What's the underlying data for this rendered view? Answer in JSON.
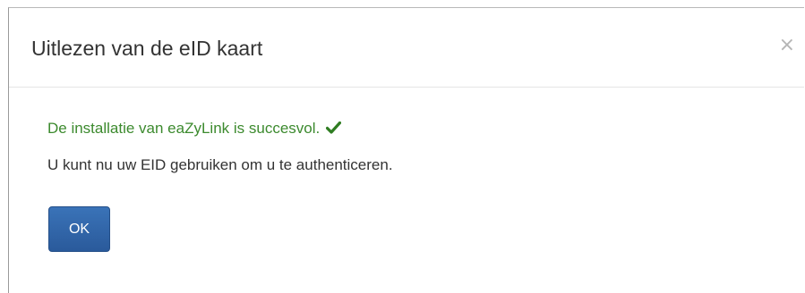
{
  "dialog": {
    "title": "Uitlezen van de eID kaart",
    "close_label": "×"
  },
  "body": {
    "success_message": "De installatie van eaZyLink is succesvol.",
    "info_message": "U kunt nu uw EID gebruiken om u te authenticeren.",
    "ok_label": "OK"
  },
  "icons": {
    "success": "check-icon",
    "close": "close-icon"
  },
  "colors": {
    "success_text": "#3c8a2e",
    "primary_button": "#2f64a8",
    "title_text": "#333333"
  }
}
